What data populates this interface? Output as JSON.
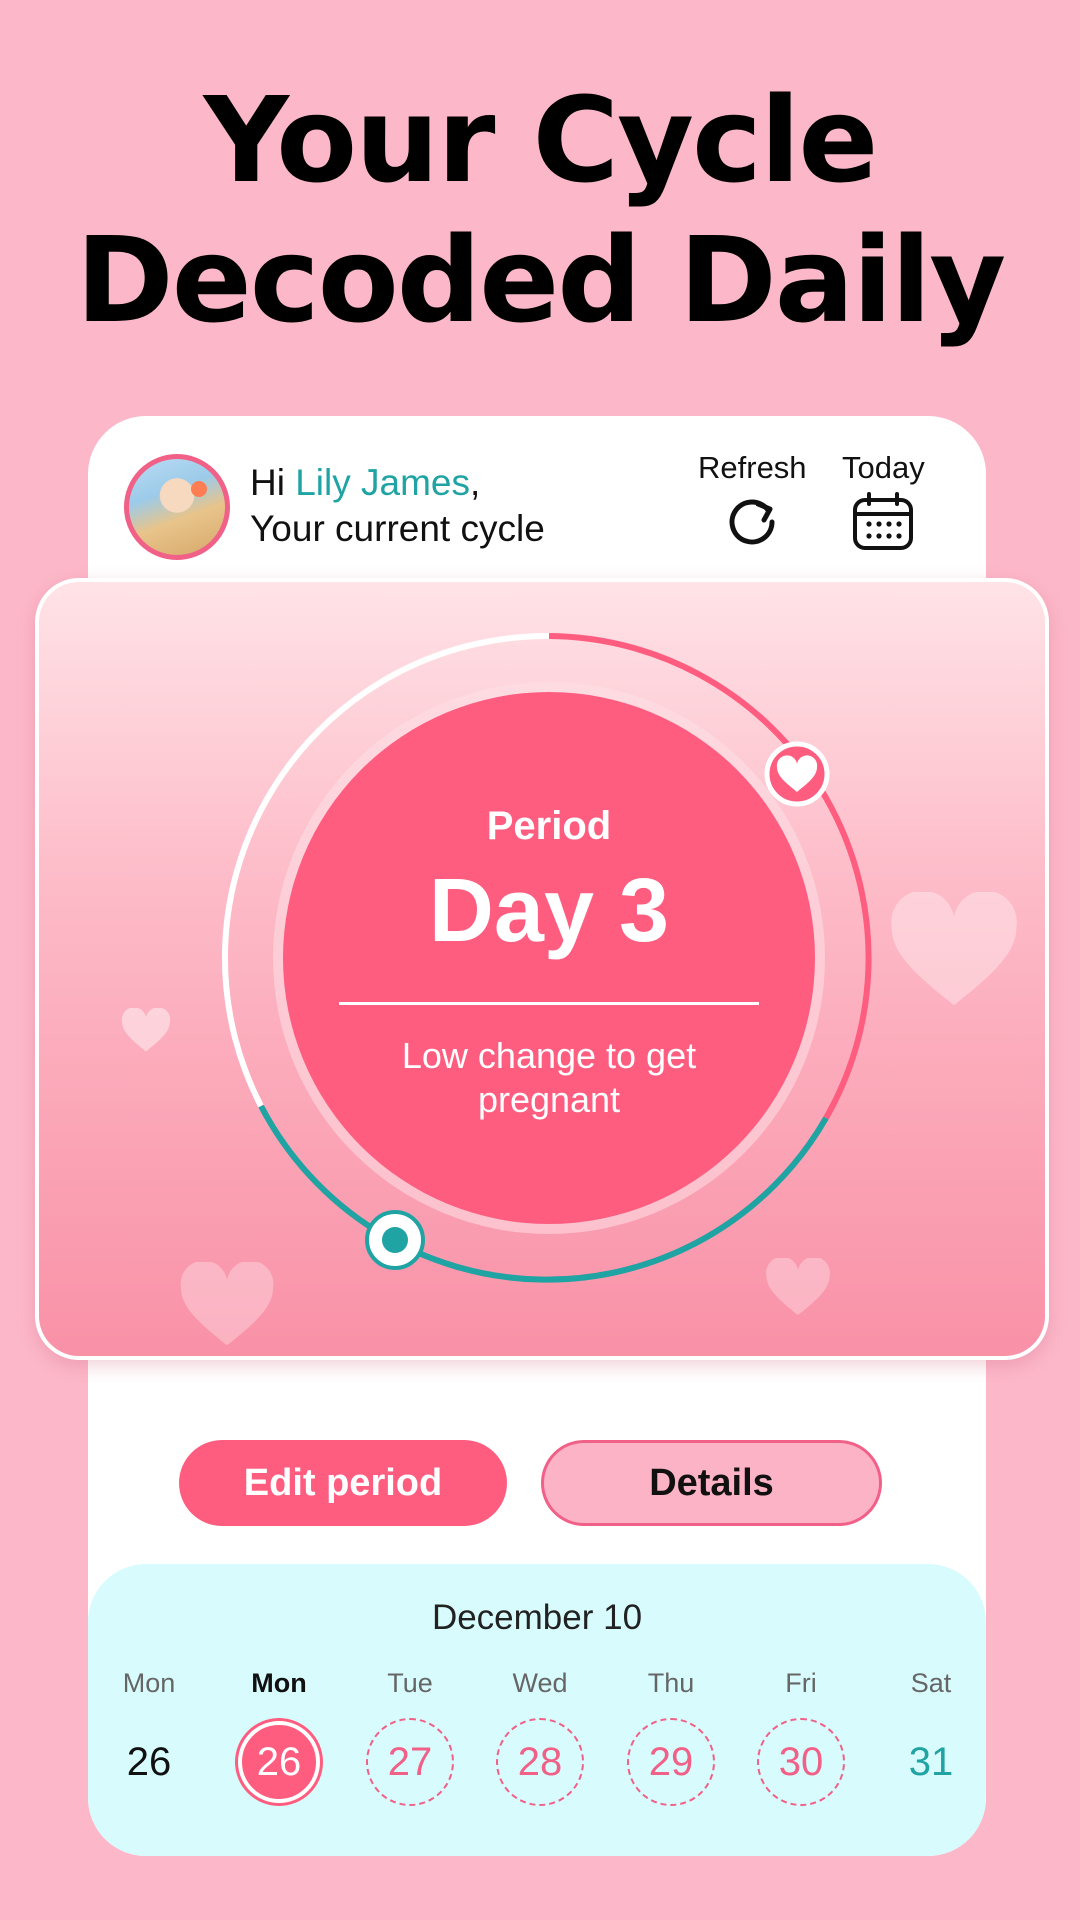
{
  "headline": {
    "line1": "Your Cycle",
    "line2": "Decoded Daily"
  },
  "header": {
    "greeting_prefix": "Hi ",
    "user_name": "Lily James",
    "greeting_suffix": ",",
    "subtitle": "Your current cycle",
    "refresh_label": "Refresh",
    "today_label": "Today"
  },
  "cycle": {
    "phase": "Period",
    "day": "Day 3",
    "chance": "Low change to get pregnant",
    "colors": {
      "period": "#fe5d80",
      "fertile": "#1fa3a3",
      "ring_rest": "#ffffff"
    }
  },
  "actions": {
    "edit": "Edit period",
    "details": "Details"
  },
  "calendar": {
    "title": "December 10",
    "days": [
      {
        "weekday": "Mon",
        "date": "26",
        "style": "plain"
      },
      {
        "weekday": "Mon",
        "date": "26",
        "style": "selected"
      },
      {
        "weekday": "Tue",
        "date": "27",
        "style": "dashed"
      },
      {
        "weekday": "Wed",
        "date": "28",
        "style": "dashed"
      },
      {
        "weekday": "Thu",
        "date": "29",
        "style": "dashed"
      },
      {
        "weekday": "Fri",
        "date": "30",
        "style": "dashed"
      },
      {
        "weekday": "Sat",
        "date": "31",
        "style": "teal"
      }
    ]
  }
}
